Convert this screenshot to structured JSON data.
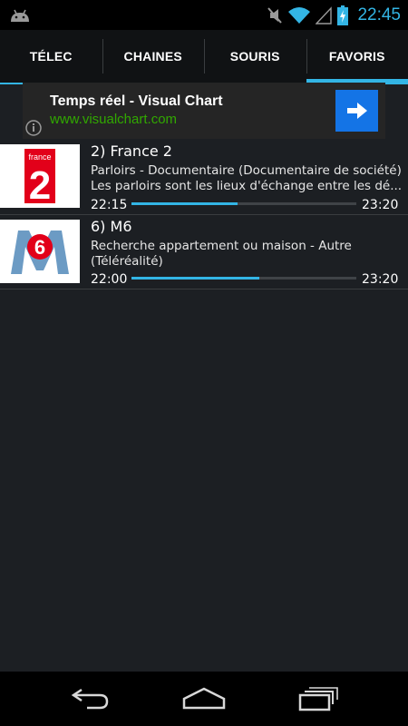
{
  "status": {
    "time": "22:45"
  },
  "tabs": [
    {
      "label": "TÉLEC",
      "active": false
    },
    {
      "label": "CHAINES",
      "active": false
    },
    {
      "label": "SOURIS",
      "active": false
    },
    {
      "label": "FAVORIS",
      "active": true
    }
  ],
  "ad": {
    "title": "Temps réel - Visual Chart",
    "url": "www.visualchart.com"
  },
  "channels": [
    {
      "name": "2) France 2",
      "logo_text": "france",
      "logo_number": "2",
      "program_line1": "Parloirs - Documentaire (Documentaire de société)",
      "program_line2": "Les parloirs sont les lieux d'échange entre les dé...",
      "start": "22:15",
      "end": "23:20",
      "progress": 0.47
    },
    {
      "name": "6) M6",
      "logo_number": "6",
      "program_line1": "Recherche appartement ou maison - Autre",
      "program_line2": "(Téléréalité)",
      "start": "22:00",
      "end": "23:20",
      "progress": 0.57
    }
  ],
  "colors": {
    "accent": "#33b5e5",
    "ad_url": "#31a800",
    "ad_button": "#1474e6"
  }
}
